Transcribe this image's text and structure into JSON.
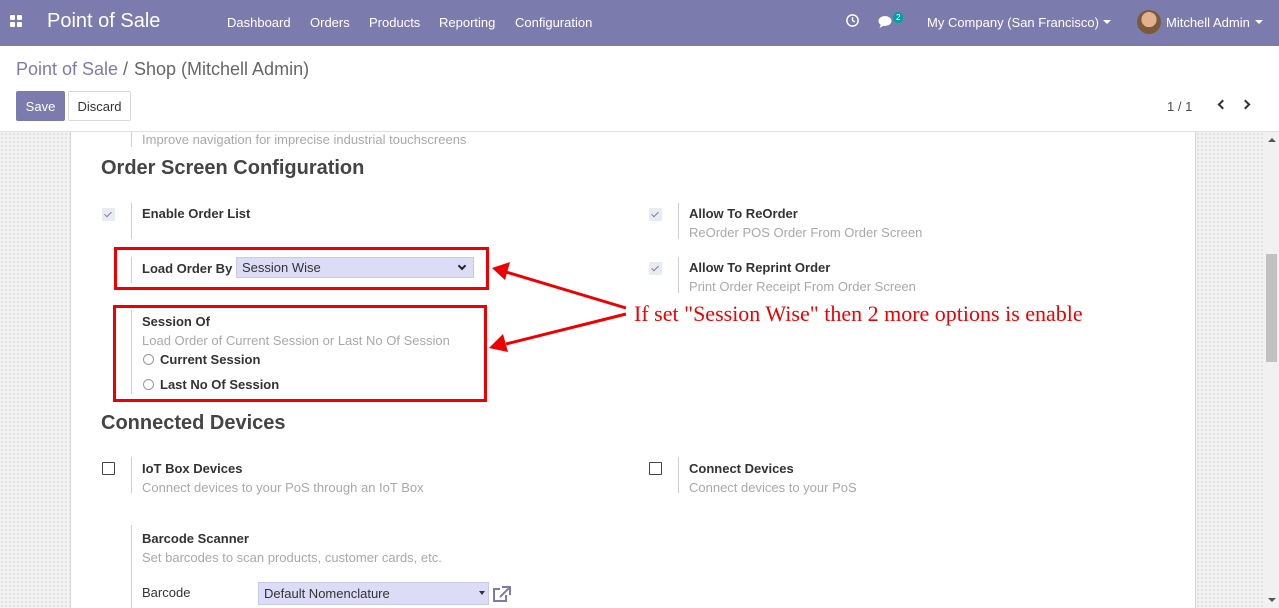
{
  "navbar": {
    "app_title": "Point of Sale",
    "menu": [
      "Dashboard",
      "Orders",
      "Products",
      "Reporting",
      "Configuration"
    ],
    "messages_count": "2",
    "company": "My Company (San Francisco)",
    "user": "Mitchell Admin",
    "icons": [
      "apps-grid-icon",
      "clock-icon",
      "chat-icon"
    ]
  },
  "breadcrumb": {
    "parent": "Point of Sale",
    "separator": "/",
    "current": "Shop (Mitchell Admin)"
  },
  "buttons": {
    "save": "Save",
    "discard": "Discard"
  },
  "pager": {
    "value": "1 / 1"
  },
  "form": {
    "top_help": "Improve navigation for imprecise industrial touchscreens",
    "order_screen": {
      "title": "Order Screen Configuration",
      "enable_order_list": {
        "label": "Enable Order List",
        "checked": true
      },
      "allow_reorder": {
        "label": "Allow To ReOrder",
        "help": "ReOrder POS Order From Order Screen",
        "checked": true
      },
      "load_order_by": {
        "label": "Load Order By",
        "value": "Session Wise"
      },
      "allow_reprint": {
        "label": "Allow To Reprint Order",
        "help": "Print Order Receipt From Order Screen",
        "checked": true
      },
      "session_of": {
        "label": "Session Of",
        "help": "Load Order of Current Session or Last No Of Session",
        "options": [
          "Current Session",
          "Last No Of Session"
        ]
      }
    },
    "connected_devices": {
      "title": "Connected Devices",
      "iot_box": {
        "label": "IoT Box Devices",
        "help": "Connect devices to your PoS through an IoT Box",
        "checked": false
      },
      "connect_devices": {
        "label": "Connect Devices",
        "help": "Connect devices to your PoS",
        "checked": false
      },
      "barcode_scanner": {
        "label": "Barcode Scanner",
        "help": "Set barcodes to scan products, customer cards, etc."
      },
      "barcode_nomenclature": {
        "label": "Barcode",
        "value": "Default Nomenclature"
      }
    }
  },
  "annotation": "If set \"Session Wise\" then 2 more options is enable",
  "colors": {
    "navbar": "#7c7bad",
    "annotation_red": "#ee0000",
    "select_bg": "#dddcf7"
  }
}
